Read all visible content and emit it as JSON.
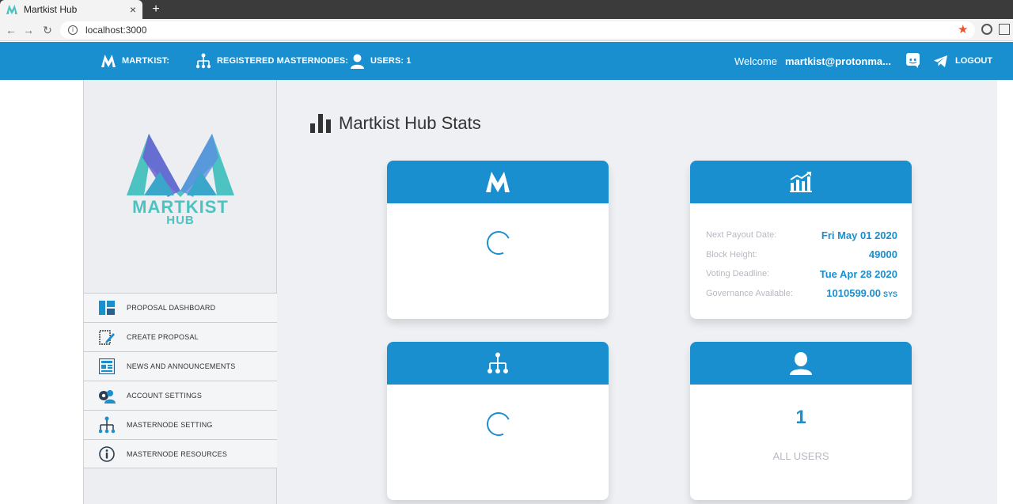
{
  "browser": {
    "tab_title": "Martkist Hub",
    "new_tab": "+",
    "close": "×",
    "url": "localhost:3000"
  },
  "header": {
    "brand_label": "MARTKIST:",
    "masternodes_label": "REGISTERED MASTERNODES:",
    "users_label": "USERS: 1",
    "welcome": "Welcome",
    "email": "martkist@protonma...",
    "logout": "LOGOUT"
  },
  "sidebar": {
    "logo_line1": "MARTKIST",
    "logo_line2": "HUB",
    "items": [
      {
        "label": "PROPOSAL DASHBOARD",
        "icon": "dashboard-icon"
      },
      {
        "label": "CREATE PROPOSAL",
        "icon": "edit-document-icon"
      },
      {
        "label": "NEWS AND ANNOUNCEMENTS",
        "icon": "news-icon"
      },
      {
        "label": "ACCOUNT SETTINGS",
        "icon": "user-settings-icon"
      },
      {
        "label": "MASTERNODE SETTING",
        "icon": "network-icon"
      },
      {
        "label": "MASTERNODE RESOURCES",
        "icon": "info-icon"
      }
    ]
  },
  "main": {
    "title": "Martkist Hub Stats",
    "governance_card": {
      "rows": [
        {
          "label": "Next Payout Date:",
          "value": "Fri May 01 2020"
        },
        {
          "label": "Block Height:",
          "value": "49000"
        },
        {
          "label": "Voting Deadline:",
          "value": "Tue Apr 28 2020"
        },
        {
          "label": "Governance Available:",
          "value": "1010599.00",
          "unit": "SYS"
        }
      ]
    },
    "users_card": {
      "count": "1",
      "label": "ALL USERS"
    }
  },
  "colors": {
    "primary": "#1a8fd0",
    "sidebar_bg": "#eceef2",
    "main_bg": "#eef0f4",
    "logo_teal": "#4cc3c1",
    "logo_purple": "#6b5fd3"
  }
}
